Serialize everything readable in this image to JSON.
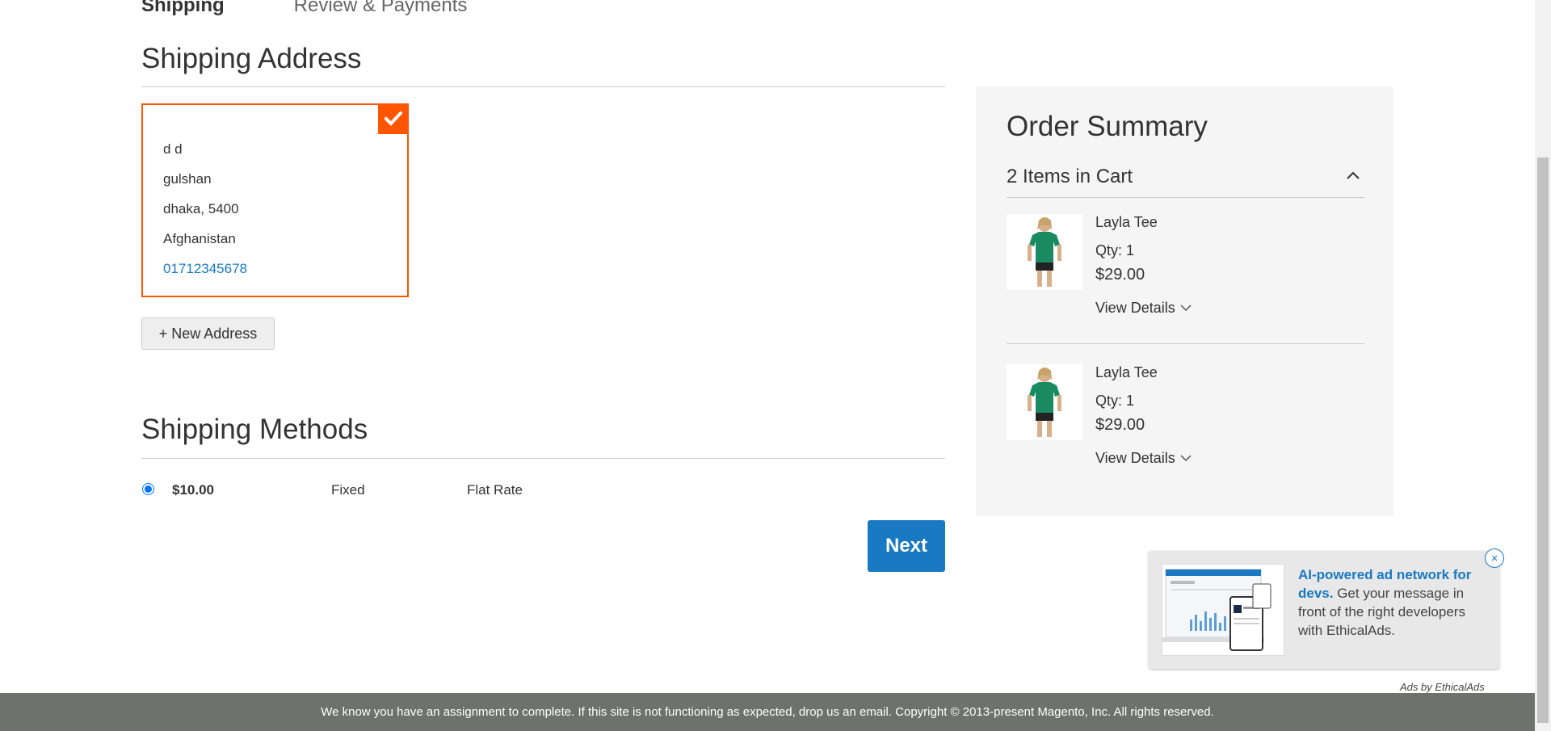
{
  "steps": {
    "shipping": "Shipping",
    "review": "Review & Payments"
  },
  "shipping_address": {
    "title": "Shipping Address",
    "address": {
      "name": "d d",
      "street": "gulshan",
      "city_zip": "dhaka, 5400",
      "country": "Afghanistan",
      "phone": "01712345678"
    },
    "new_address_label": "+ New Address"
  },
  "shipping_methods": {
    "title": "Shipping Methods",
    "method": {
      "price": "$10.00",
      "code": "Fixed",
      "carrier": "Flat Rate",
      "selected": true
    }
  },
  "next_label": "Next",
  "order_summary": {
    "title": "Order Summary",
    "cart_count": "2 Items in Cart",
    "items": [
      {
        "name": "Layla Tee",
        "qty": "Qty: 1",
        "price": "$29.00",
        "details_label": "View Details"
      },
      {
        "name": "Layla Tee",
        "qty": "Qty: 1",
        "price": "$29.00",
        "details_label": "View Details"
      }
    ]
  },
  "ad": {
    "headline": "AI-powered ad network for devs.",
    "body": " Get your message in front of the right developers with EthicalAds.",
    "close": "×",
    "attribution": "Ads by EthicalAds"
  },
  "footer": {
    "text": "We know you have an assignment to complete. If this site is not functioning as expected, drop us an email. Copyright © 2013-present Magento, Inc. All rights reserved."
  },
  "colors": {
    "accent": "#ff5501",
    "primary": "#1979c3",
    "footer_bg": "#6e716e",
    "summary_bg": "#f5f5f5"
  }
}
